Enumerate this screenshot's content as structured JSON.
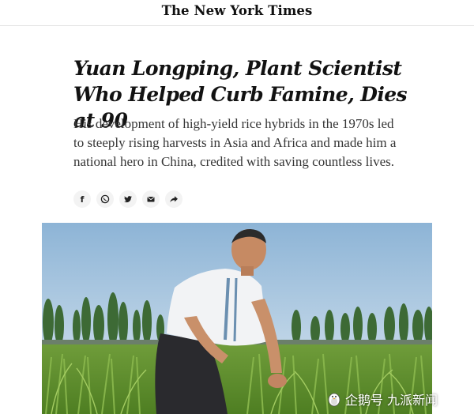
{
  "masthead": {
    "logo_text": "The New York Times"
  },
  "article": {
    "headline": "Yuan Longping, Plant Scientist Who Helped Curb Famine, Dies at 90",
    "summary": "His development of high-yield rice hybrids in the 1970s led to steeply rising harvests in Asia and Africa and made him a national hero in China, credited with saving countless lives."
  },
  "share": {
    "icons": [
      "facebook-icon",
      "whatsapp-icon",
      "twitter-icon",
      "email-icon",
      "share-icon"
    ],
    "facebook_glyph": "f"
  },
  "watermark": {
    "platform": "企鹅号",
    "account": "九派新闻"
  },
  "colors": {
    "headline": "#121212",
    "summary": "#363636",
    "icon_bg": "#f3f3f3"
  }
}
